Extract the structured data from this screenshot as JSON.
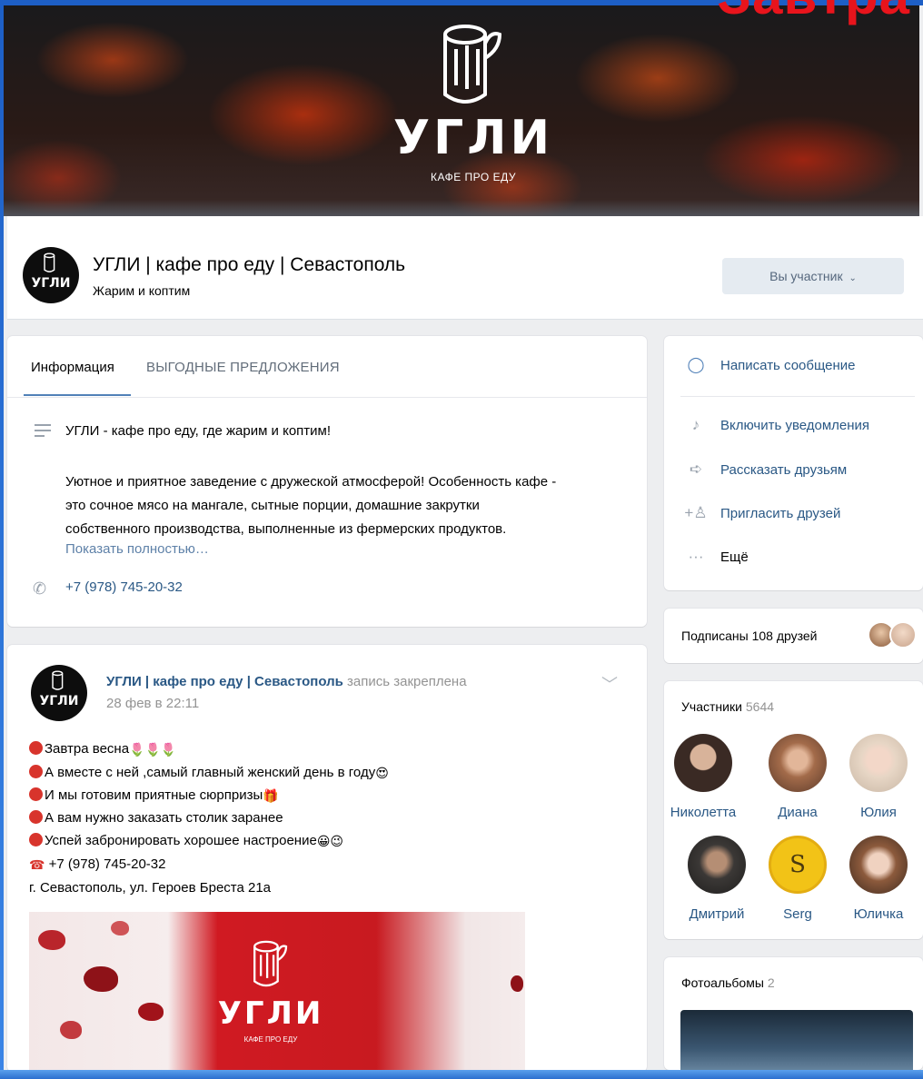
{
  "cover": {
    "logo_word": "УГЛИ",
    "logo_subtitle": "КАФЕ ПРО ЕДУ",
    "top_banner_text": "Завтра"
  },
  "header": {
    "title": "УГЛИ | кафе про еду | Севастополь",
    "status": "Жарим и коптим",
    "member_button": "Вы участник",
    "avatar_word": "УГЛИ"
  },
  "info": {
    "tabs": [
      "Информация",
      "ВЫГОДНЫЕ ПРЕДЛОЖЕНИЯ"
    ],
    "description_lines": [
      "УГЛИ - кафе про еду, где жарим и коптим!",
      "",
      "Уютное и приятное заведение с дружеской атмосферой! Особенность кафе -",
      "это сочное мясо на мангале, сытные порции, домашние закрутки",
      "собственного производства, выполненные из фермерских продуктов."
    ],
    "show_more": "Показать полностью…",
    "phone": "+7 (978) 745-20-32"
  },
  "post": {
    "author": "УГЛИ | кафе про еду | Севастополь",
    "pinned_note": "запись закреплена",
    "date": "28 фев в 22:11",
    "lines": [
      "Завтра весна",
      "А вместе с ней ,самый главный женский день в году",
      "И мы готовим приятные сюрпризы",
      "А вам нужно заказать столик заранее",
      "Успей забронировать хорошее настроение"
    ],
    "phone_line": "+7 (978) 745-20-32",
    "address": "г. Севастополь, ул. Героев Бреста 21а",
    "image_logo_word": "УГЛИ",
    "image_logo_sub": "КАФЕ ПРО ЕДУ"
  },
  "sidebar": {
    "actions": [
      {
        "label": "Написать сообщение",
        "icon": "message-bubble-icon"
      },
      {
        "label": "Включить уведомления",
        "icon": "bell-icon"
      },
      {
        "label": "Рассказать друзьям",
        "icon": "share-arrow-icon"
      },
      {
        "label": "Пригласить друзей",
        "icon": "add-person-icon"
      },
      {
        "label": "Ещё",
        "icon": "more-dots-icon"
      }
    ],
    "friends_text": "Подписаны 108 друзей",
    "members_title": "Участники",
    "members_count": "5644",
    "members": [
      "Николетта",
      "Диана",
      "Юлия",
      "Дмитрий",
      "Serg",
      "Юличка"
    ],
    "albums_title": "Фотоальбомы",
    "albums_count": "2"
  },
  "colors": {
    "accent": "#5181b8",
    "link": "#2a5885",
    "page_bg": "#edeef0",
    "brand_red": "#e8141c"
  }
}
